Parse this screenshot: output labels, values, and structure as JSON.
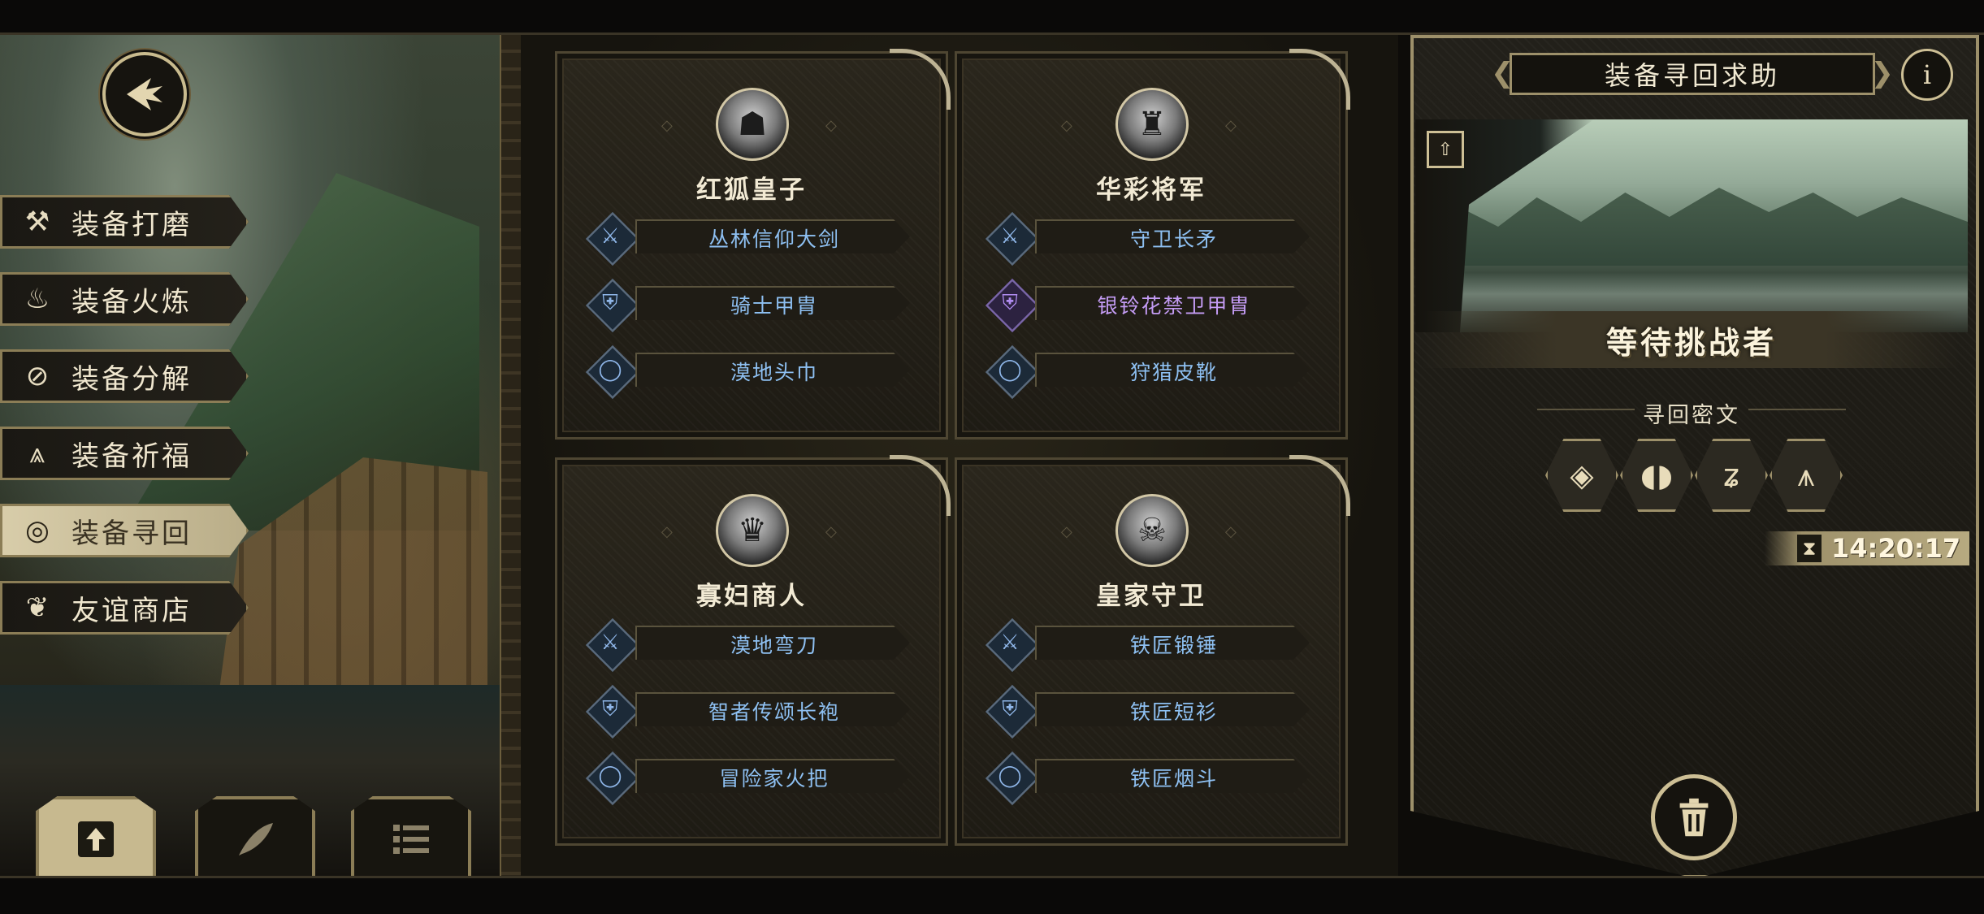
{
  "menu": {
    "items": [
      {
        "label": "装备打磨",
        "icon": "hammer-icon",
        "active": false
      },
      {
        "label": "装备火炼",
        "icon": "flame-icon",
        "active": false
      },
      {
        "label": "装备分解",
        "icon": "dismantle-icon",
        "active": false
      },
      {
        "label": "装备祈福",
        "icon": "pray-icon",
        "active": false
      },
      {
        "label": "装备寻回",
        "icon": "target-icon",
        "active": true
      },
      {
        "label": "友谊商店",
        "icon": "fox-icon",
        "active": false
      }
    ]
  },
  "bottom_tabs": [
    {
      "icon": "upload-icon",
      "active": true
    },
    {
      "icon": "feather-icon",
      "active": false
    },
    {
      "icon": "list-icon",
      "active": false
    }
  ],
  "cards": [
    {
      "owner": "红狐皇子",
      "portrait": "wolf-portrait-icon",
      "items": [
        {
          "slot": "weapon",
          "name": "丛林信仰大剑",
          "rarity": "blue"
        },
        {
          "slot": "armor",
          "name": "骑士甲胄",
          "rarity": "blue"
        },
        {
          "slot": "accessory",
          "name": "漠地头巾",
          "rarity": "blue"
        }
      ]
    },
    {
      "owner": "华彩将军",
      "portrait": "general-portrait-icon",
      "items": [
        {
          "slot": "weapon",
          "name": "守卫长矛",
          "rarity": "blue"
        },
        {
          "slot": "armor",
          "name": "银铃花禁卫甲胄",
          "rarity": "purple"
        },
        {
          "slot": "accessory",
          "name": "狩猎皮靴",
          "rarity": "blue"
        }
      ]
    },
    {
      "owner": "寡妇商人",
      "portrait": "widow-portrait-icon",
      "items": [
        {
          "slot": "weapon",
          "name": "漠地弯刀",
          "rarity": "blue"
        },
        {
          "slot": "armor",
          "name": "智者传颂长袍",
          "rarity": "blue"
        },
        {
          "slot": "accessory",
          "name": "冒险家火把",
          "rarity": "blue"
        }
      ]
    },
    {
      "owner": "皇家守卫",
      "portrait": "guard-portrait-icon",
      "items": [
        {
          "slot": "weapon",
          "name": "铁匠锻锤",
          "rarity": "blue"
        },
        {
          "slot": "armor",
          "name": "铁匠短衫",
          "rarity": "blue"
        },
        {
          "slot": "accessory",
          "name": "铁匠烟斗",
          "rarity": "blue"
        }
      ]
    }
  ],
  "right_panel": {
    "title": "装备寻回求助",
    "info_symbol": "i",
    "status": "等待挑战者",
    "cipher_label": "寻回密文",
    "runes": [
      "rune-diamond-icon",
      "rune-split-icon",
      "rune-knot-icon",
      "rune-gate-icon"
    ],
    "timer": "14:20:17"
  },
  "colors": {
    "accent_gold": "#9d906a",
    "rarity_blue": "#8ec0f2",
    "rarity_purple": "#c49cf5",
    "active_menu": "#d8cdaa"
  }
}
